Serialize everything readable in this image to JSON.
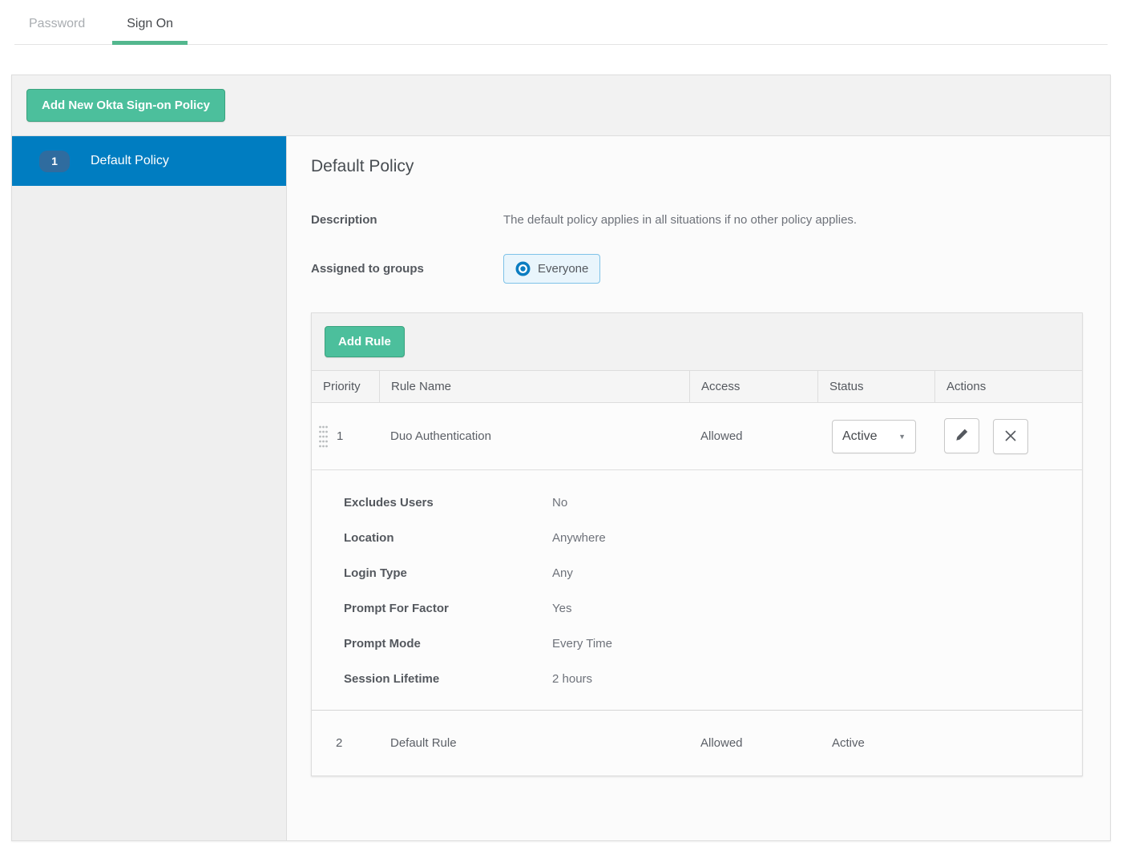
{
  "tabs": [
    {
      "label": "Password",
      "active": false
    },
    {
      "label": "Sign On",
      "active": true
    }
  ],
  "toolbar": {
    "add_policy_label": "Add New Okta Sign-on Policy"
  },
  "sidebar": {
    "policies": [
      {
        "number": "1",
        "name": "Default Policy",
        "selected": true
      }
    ]
  },
  "policy": {
    "title": "Default Policy",
    "fields": [
      {
        "label": "Description",
        "value": "The default policy applies in all situations if no other policy applies."
      },
      {
        "label": "Assigned to groups",
        "value": "Everyone"
      }
    ]
  },
  "rules": {
    "add_rule_label": "Add Rule",
    "columns": [
      "Priority",
      "Rule Name",
      "Access",
      "Status",
      "Actions"
    ],
    "rows": [
      {
        "priority": "1",
        "name": "Duo Authentication",
        "access": "Allowed",
        "status": "Active"
      },
      {
        "priority": "2",
        "name": "Default Rule",
        "access": "Allowed",
        "status": "Active"
      }
    ],
    "details": [
      {
        "label": "Excludes Users",
        "value": "No"
      },
      {
        "label": "Location",
        "value": "Anywhere"
      },
      {
        "label": "Login Type",
        "value": "Any"
      },
      {
        "label": "Prompt For Factor",
        "value": "Yes"
      },
      {
        "label": "Prompt Mode",
        "value": "Every Time"
      },
      {
        "label": "Session Lifetime",
        "value": "2 hours"
      }
    ]
  },
  "colors": {
    "accent_green": "#4cbf9c",
    "accent_green_border": "#3aa37e",
    "selected_blue": "#007dc1",
    "badge_blue": "#2f6c9f",
    "chip_bg": "#e9f5fc",
    "chip_border": "#7ec2e8"
  }
}
